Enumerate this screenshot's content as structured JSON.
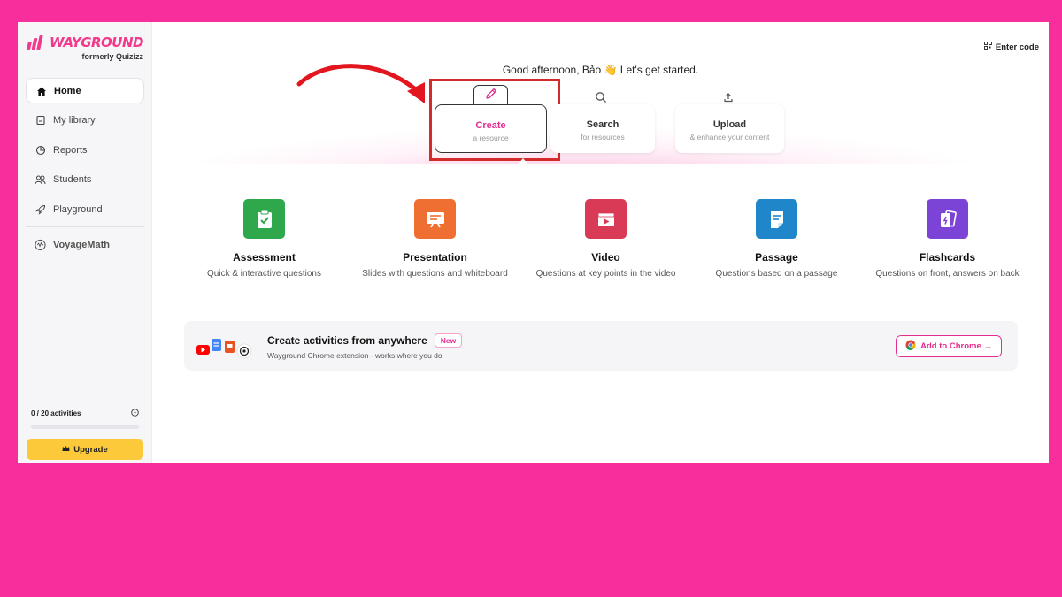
{
  "brand": {
    "name": "WAYGROUND",
    "subtitle": "formerly Quizizz",
    "color": "#f2398c"
  },
  "sidebar": {
    "items": [
      {
        "label": "Home",
        "icon": "home-icon",
        "active": true
      },
      {
        "label": "My library",
        "icon": "library-icon"
      },
      {
        "label": "Reports",
        "icon": "reports-icon"
      },
      {
        "label": "Students",
        "icon": "students-icon"
      },
      {
        "label": "Playground",
        "icon": "rocket-icon"
      }
    ],
    "voyage": "VoyageMath",
    "usage": "0 / 20 activities",
    "upgrade": "Upgrade"
  },
  "header": {
    "enter_code": "Enter code"
  },
  "greeting": "Good afternoon, Bảo 👋 Let's get started.",
  "tabs": [
    {
      "title": "Create",
      "subtitle": "a resource",
      "icon": "pencil-icon"
    },
    {
      "title": "Search",
      "subtitle": "for resources",
      "icon": "search-icon"
    },
    {
      "title": "Upload",
      "subtitle": "& enhance your content",
      "icon": "upload-icon"
    }
  ],
  "types": [
    {
      "title": "Assessment",
      "desc": "Quick & interactive questions",
      "color": "#2ea84a",
      "icon": "clipboard-check-icon"
    },
    {
      "title": "Presentation",
      "desc": "Slides with questions and whiteboard",
      "color": "#ef6f33",
      "icon": "presentation-icon"
    },
    {
      "title": "Video",
      "desc": "Questions at key points in the video",
      "color": "#d93a55",
      "icon": "video-icon"
    },
    {
      "title": "Passage",
      "desc": "Questions based on a passage",
      "color": "#1f86c9",
      "icon": "passage-icon"
    },
    {
      "title": "Flashcards",
      "desc": "Questions on front, answers on back",
      "color": "#7b44d6",
      "icon": "flashcards-icon"
    }
  ],
  "promo": {
    "title": "Create activities from anywhere",
    "badge": "New",
    "subtitle": "Wayground Chrome extension - works where you do",
    "button": "Add to Chrome →"
  }
}
